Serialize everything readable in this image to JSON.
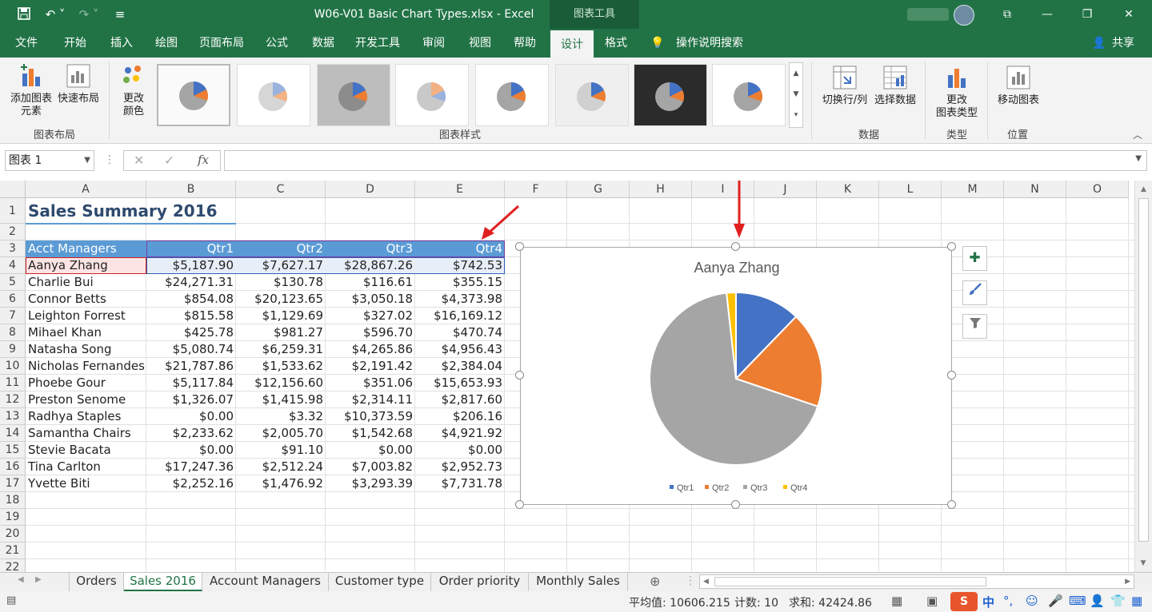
{
  "titlebar": {
    "doc_title": "W06-V01 Basic Chart Types.xlsx  -  Excel",
    "context_tab": "图表工具",
    "save_icon": "save-icon",
    "undo_icon": "undo-icon",
    "redo_icon": "redo-icon"
  },
  "ribbon_tabs": [
    "文件",
    "开始",
    "插入",
    "绘图",
    "页面布局",
    "公式",
    "数据",
    "开发工具",
    "审阅",
    "视图",
    "帮助",
    "设计",
    "格式"
  ],
  "ribbon_active_tab": "设计",
  "tell_me": "操作说明搜索",
  "share": "共享",
  "ribbon": {
    "add_element": "添加图表\n元素",
    "quick_layout": "快速布局",
    "change_colors": "更改\n颜色",
    "group_layout": "图表布局",
    "group_styles": "图表样式",
    "switch_row_col": "切换行/列",
    "select_data": "选择数据",
    "group_data": "数据",
    "change_type": "更改\n图表类型",
    "group_type": "类型",
    "move_chart": "移动图表",
    "group_location": "位置"
  },
  "formula_bar": {
    "name_box": "图表 1",
    "fx": "fx",
    "formula": ""
  },
  "columns": [
    "A",
    "B",
    "C",
    "D",
    "E",
    "F",
    "G",
    "H",
    "I",
    "J",
    "K",
    "L",
    "M",
    "N",
    "O"
  ],
  "rows": [
    "1",
    "2",
    "3",
    "4",
    "5",
    "6",
    "7",
    "8",
    "9",
    "10",
    "11",
    "12",
    "13",
    "14",
    "15",
    "16",
    "17",
    "18",
    "19",
    "20",
    "21",
    "22"
  ],
  "sheet": {
    "title": "Sales Summary 2016",
    "header": [
      "Acct Managers",
      "Qtr1",
      "Qtr2",
      "Qtr3",
      "Qtr4"
    ],
    "data": [
      [
        "Aanya Zhang",
        "$5,187.90",
        "$7,627.17",
        "$28,867.26",
        "$742.53"
      ],
      [
        "Charlie Bui",
        "$24,271.31",
        "$130.78",
        "$116.61",
        "$355.15"
      ],
      [
        "Connor Betts",
        "$854.08",
        "$20,123.65",
        "$3,050.18",
        "$4,373.98"
      ],
      [
        "Leighton Forrest",
        "$815.58",
        "$1,129.69",
        "$327.02",
        "$16,169.12"
      ],
      [
        "Mihael Khan",
        "$425.78",
        "$981.27",
        "$596.70",
        "$470.74"
      ],
      [
        "Natasha Song",
        "$5,080.74",
        "$6,259.31",
        "$4,265.86",
        "$4,956.43"
      ],
      [
        "Nicholas Fernandes",
        "$21,787.86",
        "$1,533.62",
        "$2,191.42",
        "$2,384.04"
      ],
      [
        "Phoebe Gour",
        "$5,117.84",
        "$12,156.60",
        "$351.06",
        "$15,653.93"
      ],
      [
        "Preston Senome",
        "$1,326.07",
        "$1,415.98",
        "$2,314.11",
        "$2,817.60"
      ],
      [
        "Radhya Staples",
        "$0.00",
        "$3.32",
        "$10,373.59",
        "$206.16"
      ],
      [
        "Samantha Chairs",
        "$2,233.62",
        "$2,005.70",
        "$1,542.68",
        "$4,921.92"
      ],
      [
        "Stevie Bacata",
        "$0.00",
        "$91.10",
        "$0.00",
        "$0.00"
      ],
      [
        "Tina Carlton",
        "$17,247.36",
        "$2,512.24",
        "$7,003.82",
        "$2,952.73"
      ],
      [
        "Yvette Biti",
        "$2,252.16",
        "$1,476.92",
        "$3,293.39",
        "$7,731.78"
      ]
    ]
  },
  "chart_data": {
    "type": "pie",
    "title": "Aanya Zhang",
    "categories": [
      "Qtr1",
      "Qtr2",
      "Qtr3",
      "Qtr4"
    ],
    "values": [
      5187.9,
      7627.17,
      28867.26,
      742.53
    ],
    "colors": [
      "#4472c4",
      "#ed7d31",
      "#a5a5a5",
      "#ffc000"
    ],
    "legend": "bottom"
  },
  "chart_buttons": {
    "add": "plus-icon",
    "style": "brush-icon",
    "filter": "filter-icon"
  },
  "sheet_tabs": [
    "Orders",
    "Sales 2016",
    "Account Managers",
    "Customer type",
    "Order priority",
    "Monthly Sales"
  ],
  "active_sheet": "Sales 2016",
  "status": {
    "average": "平均值: 10606.215",
    "count": "计数: 10",
    "sum": "求和: 42424.86"
  }
}
